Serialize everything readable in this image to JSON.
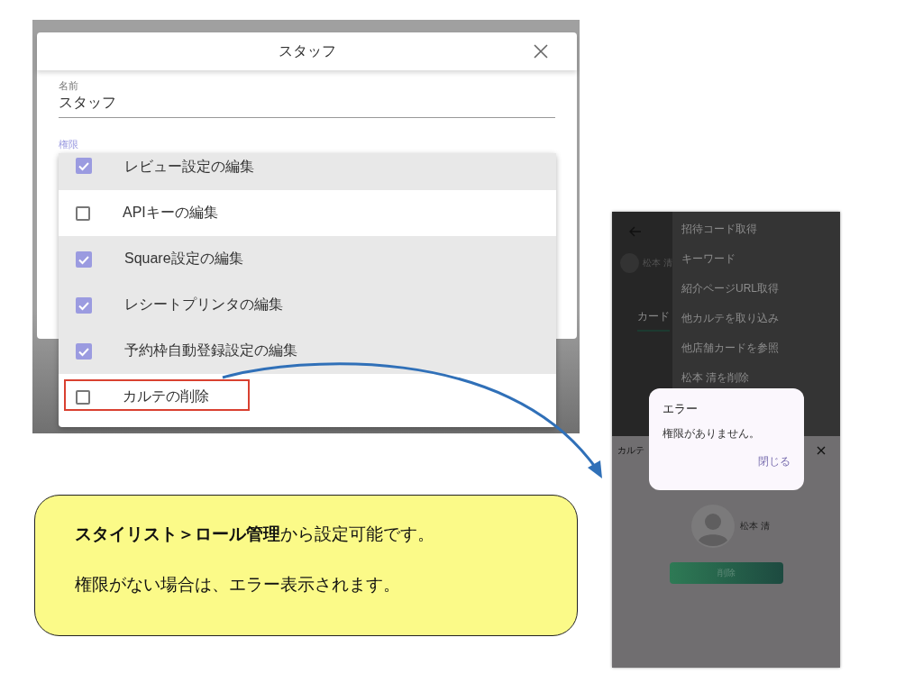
{
  "staff_dialog": {
    "title": "スタッフ",
    "name_field": {
      "label": "名前",
      "value": "スタッフ"
    },
    "permissions_label": "権限",
    "permissions": [
      {
        "label": "レビュー設定の編集",
        "checked": true,
        "highlighted": false
      },
      {
        "label": "APIキーの編集",
        "checked": false,
        "highlighted": false
      },
      {
        "label": "Square設定の編集",
        "checked": true,
        "highlighted": false
      },
      {
        "label": "レシートプリンタの編集",
        "checked": true,
        "highlighted": false
      },
      {
        "label": "予約枠自動登録設定の編集",
        "checked": true,
        "highlighted": false
      },
      {
        "label": "カルテの削除",
        "checked": false,
        "highlighted": true
      }
    ]
  },
  "phone": {
    "back_panel": {
      "name": "松本 清",
      "tab": "カード"
    },
    "menu": [
      "招待コード取得",
      "キーワード",
      "紹介ページURL取得",
      "他カルテを取り込み",
      "他店舗カードを参照",
      "松本 清を削除"
    ],
    "sheet": {
      "title": "カルテ",
      "profile_name": "松本 清",
      "delete_button": "削除"
    },
    "error_dialog": {
      "title": "エラー",
      "message": "権限がありません。",
      "close_button": "閉じる"
    }
  },
  "note": {
    "lines": [
      "**スタイリスト＞ロール管理**から設定可能です。",
      "権限がない場合は、エラー表示されます。"
    ]
  }
}
